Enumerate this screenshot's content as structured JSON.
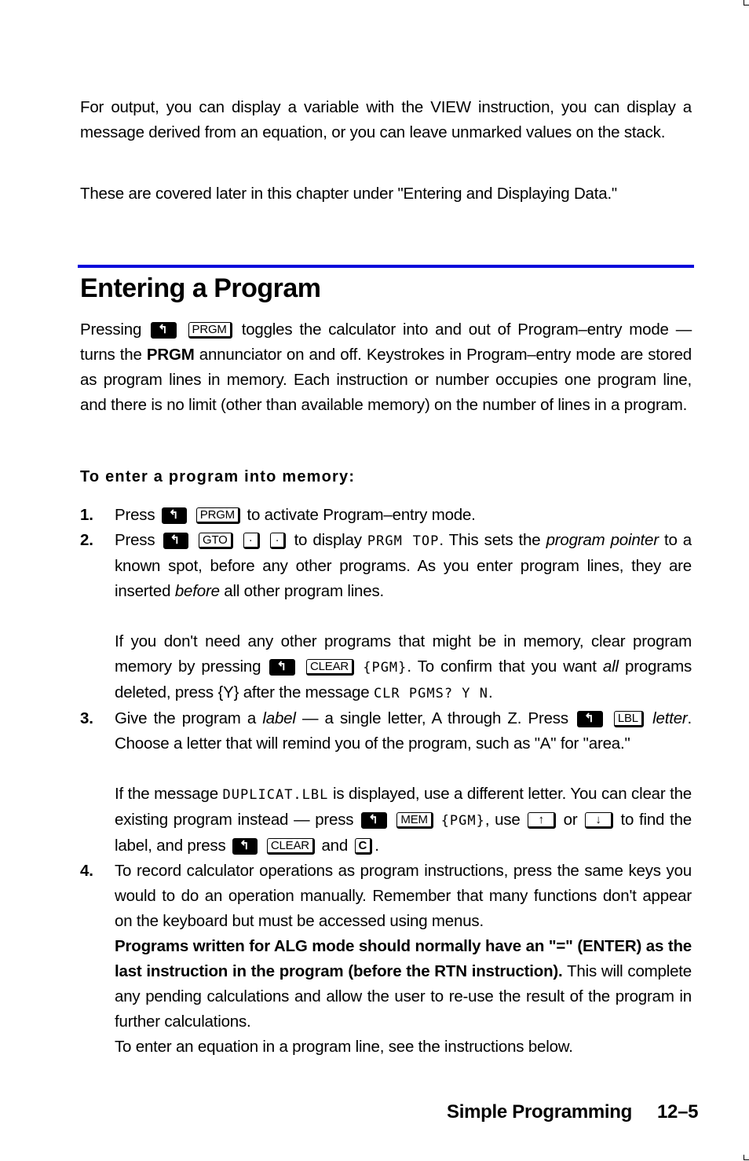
{
  "intro": {
    "p1": "For output, you can display a variable with the VIEW instruction, you can display a message derived from an equation, or you can leave unmarked values on the stack.",
    "p2": "These are covered later in this chapter under \"Entering and Displaying Data.\""
  },
  "section": {
    "title": "Entering a Program",
    "rule_color": "#0a0adb",
    "para": {
      "pre": "Pressing",
      "key_shift": "↰",
      "key_prgm": "PRGM",
      "mid": "toggles the calculator into and out of Program–entry mode — turns the",
      "bold": "PRGM",
      "post": "annunciator on and off. Keystrokes in Program–entry mode are stored as program lines in memory. Each instruction or number occupies one program line, and there is no limit (other than available memory) on the number of lines in a program."
    },
    "subheading": "To enter a program into memory:"
  },
  "steps": [
    {
      "num": "1.",
      "press": "Press",
      "keys": [
        "↰",
        "PRGM"
      ],
      "text": "to activate Program–entry mode."
    },
    {
      "num": "2.",
      "press": "Press",
      "keys": [
        "↰",
        "GTO",
        "·",
        "·"
      ],
      "a": "to display",
      "lcd": "PRGM TOP",
      "b": ". This sets the",
      "italic": "program pointer",
      "c": "to a known spot, before any other programs. As you enter program lines, they are inserted",
      "italic2": "before",
      "d": "all other program lines.",
      "note": {
        "a": "If you don't need any other programs that might be in memory, clear program memory by pressing",
        "keys": [
          "↰",
          "CLEAR"
        ],
        "menu": "{PGM}",
        "b": ". To confirm that you want",
        "italic": "all",
        "c": "programs deleted, press {Y} after the message",
        "lcd": "CLR PGMS? Y N",
        "d": "."
      }
    },
    {
      "num": "3.",
      "a": "Give the program a",
      "italic": "label",
      "b": "— a single letter, A through Z. Press",
      "keys": [
        "↰",
        "LBL"
      ],
      "italic2": "letter",
      "c": ". Choose a letter that will remind you of the program, such as \"A\" for \"area.\"",
      "note": {
        "a": "If the message",
        "lcd": "DUPLICAT.LBL",
        "b": "is displayed, use a different letter. You can clear the existing program instead — press",
        "keys1": [
          "↰",
          "MEM"
        ],
        "menu": "{PGM}",
        "c": ", use",
        "key_up": "↑",
        "d": "or",
        "key_down": "↓",
        "e": "to find the label, and press",
        "keys2": [
          "↰",
          "CLEAR"
        ],
        "f": "and",
        "key_c": "C",
        "g": "."
      }
    },
    {
      "num": "4.",
      "a": "To record calculator operations as program instructions, press the same keys you would to do an operation manually. Remember that many functions don't appear on the keyboard but must be accessed using menus.",
      "bold": "Programs written for ALG mode should normally have an \"=\" (ENTER) as the last instruction in the program (before the RTN instruction).",
      "b": "This will complete any pending calculations and allow the user to re-use the result of the program in further calculations.",
      "c": "To enter an equation in a program line, see the instructions below."
    }
  ],
  "footer": {
    "chapter": "Simple Programming",
    "page": "12–5"
  }
}
